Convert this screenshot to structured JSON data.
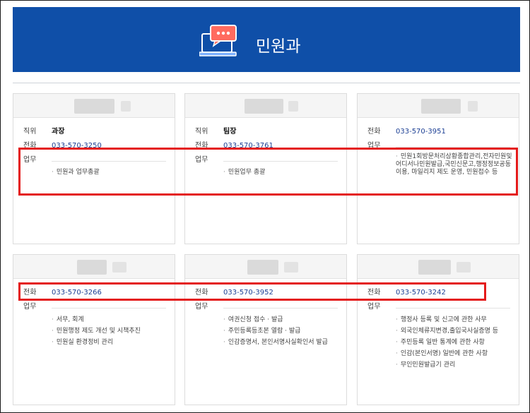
{
  "banner": {
    "title": "민원과",
    "icon": "chat-laptop-icon",
    "bg_color": "#0f4fa8"
  },
  "labels": {
    "position": "직위",
    "phone": "전화",
    "duty": "업무"
  },
  "cards": [
    {
      "position": "과장",
      "phone": "033-570-3250",
      "duties": [
        "민원과 업무총괄"
      ]
    },
    {
      "position": "팀장",
      "phone": "033-570-3761",
      "duties": [
        "민원업무 총괄"
      ]
    },
    {
      "phone": "033-570-3951",
      "duties": [
        "민원1회방문처리상황종합관리,전자민원및 어디서나민원발급,국민신문고,행정정보공동이용, 마일리지 제도 운영, 민원접수 등"
      ]
    },
    {
      "phone": "033-570-3266",
      "duties": [
        "서무, 회계",
        "민원행정 제도 개선 및 시책추진",
        "민원실 환경정비 관리"
      ]
    },
    {
      "phone": "033-570-3952",
      "duties": [
        "여권신청 접수 · 발급",
        "주민등록등초본 열람 · 발급",
        "인감증명서, 본인서명사실확인서 발급"
      ]
    },
    {
      "phone": "033-570-3242",
      "duties": [
        "행정사 등록 및 신고에 관한 사무",
        "외국인체류지변경,출입국사실증명 등",
        "주민등록 일반 통계에 관한 사항",
        "인감(본인서명) 일반에 관한 사항",
        "무인민원발급기 관리"
      ]
    }
  ],
  "colors": {
    "highlight": "#e41a1a",
    "phone_link": "#1c3f94"
  }
}
